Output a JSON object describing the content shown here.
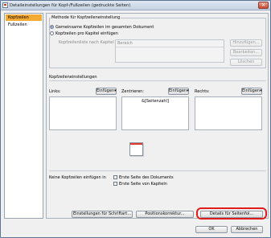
{
  "window": {
    "title": "Detaileinstellungen für Kopf-/Fußzeilen (gedruckte Seiten)",
    "close_glyph": "✕"
  },
  "nav": {
    "items": [
      {
        "label": "Kopfzeilen",
        "active": true
      },
      {
        "label": "Fußzeilen",
        "active": false
      }
    ]
  },
  "method": {
    "legend": "Methode für Kopfzeileneinstellung",
    "option_common": "Gemeinsame Kopfzeilen im gesamten Dokument",
    "option_per_chapter": "Kopfzeilen pro Kapitel einfügen",
    "list_label": "Kopfzeilenliste nach Kapitel",
    "column_header": "Bereich",
    "add_button": "Hinzufügen...",
    "edit_button": "Bearbeiten...",
    "delete_button": "Löschen"
  },
  "header_settings": {
    "legend": "Kopfzeileneinstellungen",
    "left_label": "Links:",
    "center_label": "Zentrieren:",
    "right_label": "Rechts:",
    "insert_button": "Einfügen▾",
    "center_value": "&[Seitenzahl]",
    "left_value": "",
    "right_value": ""
  },
  "exclusions": {
    "label": "Keine Kopfzeilen einfügen in",
    "first_page_doc": "Erste Seite des Dokuments",
    "first_page_chapter": "Erste Seite von Kapiteln"
  },
  "bottom_buttons": {
    "font_settings": "Einstellungen für Schriftart...",
    "position_correction": "Positionskorrektur...",
    "page_number_details": "Details für Seitenfol..."
  },
  "footer_buttons": {
    "ok": "OK",
    "cancel": "Abbrechen"
  },
  "colors": {
    "nav_active": "#f4aa33",
    "highlight": "#e01c1c"
  }
}
